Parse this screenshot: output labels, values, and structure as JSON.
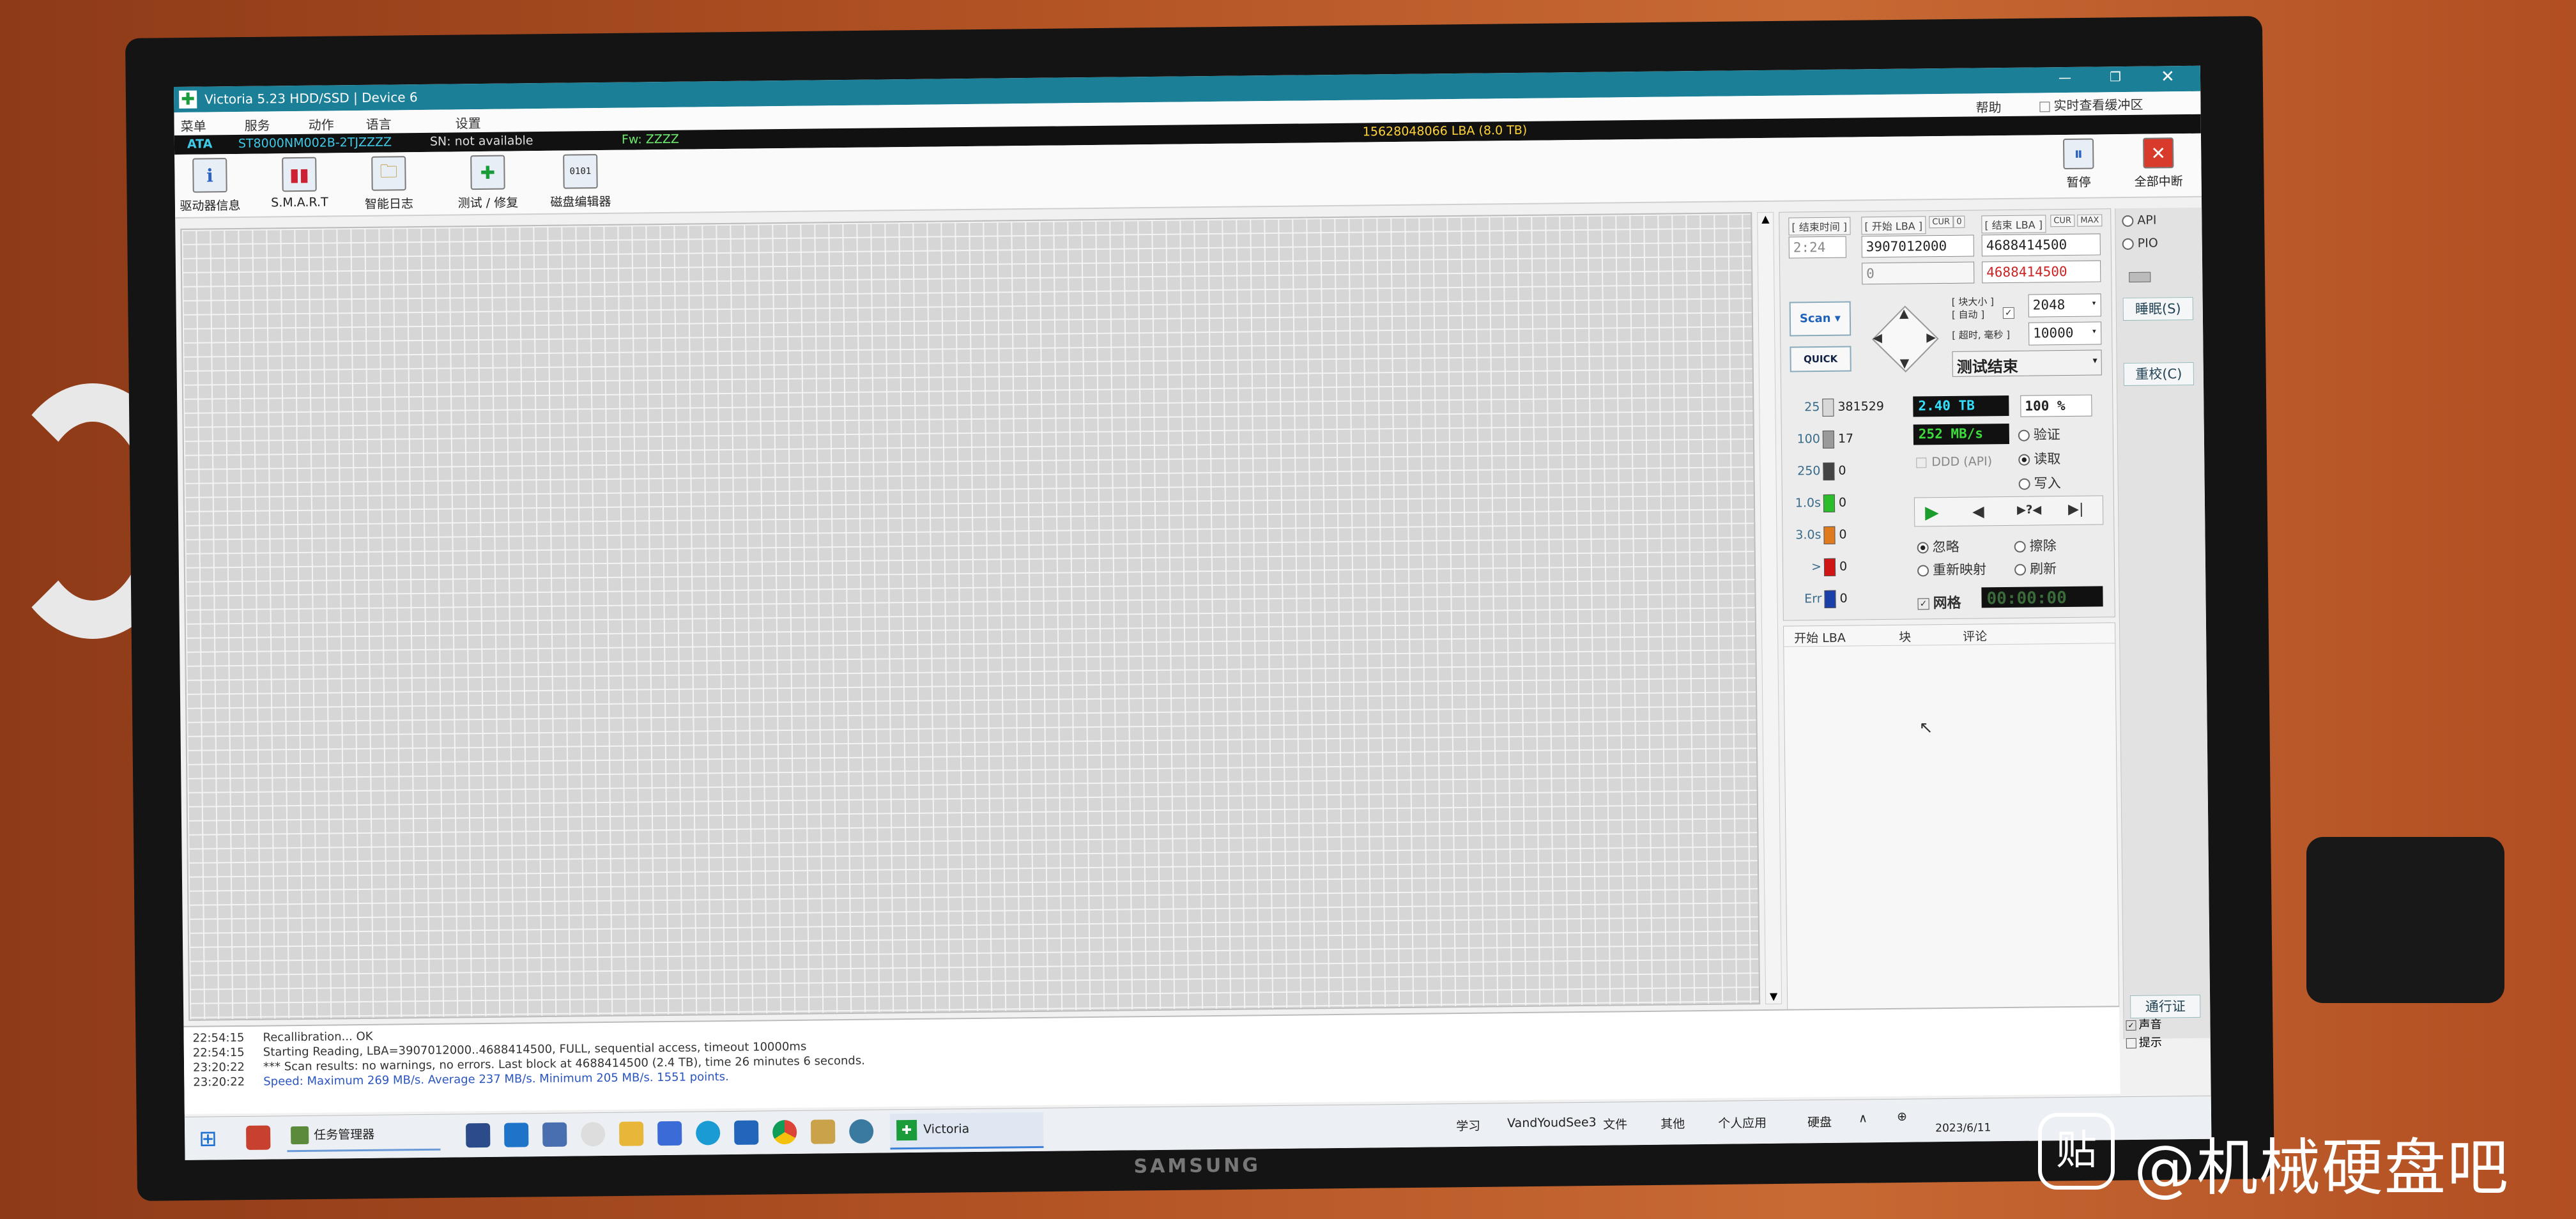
{
  "window": {
    "title": "Victoria 5.23 HDD/SSD | Device 6"
  },
  "menu": {
    "items": [
      "菜单",
      "服务",
      "动作",
      "语言",
      "设置"
    ],
    "help": "帮助",
    "realtime": "实时查看缓冲区"
  },
  "info": {
    "iface": "ATA",
    "model": "ST8000NM002B-2TJZZZZ",
    "sn": "SN: not available",
    "fw": "Fw: ZZZZ",
    "capacity": "15628048066 LBA (8.0 TB)"
  },
  "toolbar": {
    "buttons": [
      "驱动器信息",
      "S.M.A.R.T",
      "智能日志",
      "测试 / 修复",
      "磁盘编辑器"
    ],
    "pause": "暂停",
    "abort": "全部中断"
  },
  "scan": {
    "time_label": "[ 结束时间 ]",
    "time_value": "2:24",
    "start_label": "[ 开始 LBA ]",
    "cur": "CUR",
    "zero": "0",
    "start_value": "3907012000",
    "end_label": "[ 结束 LBA ]",
    "max": "MAX",
    "end_value": "4688414500",
    "pos_value": "0",
    "end_cur": "4688414500",
    "scan_btn": "Scan",
    "quick_btn": "QUICK",
    "block_label": "[ 块大小 ]",
    "auto_label": "[ 自动 ]",
    "block_value": "2048",
    "timeout_label": "[ 超时, 毫秒 ]",
    "timeout_value": "10000",
    "status": "测试结束"
  },
  "counts": [
    {
      "label": "25",
      "value": "381529",
      "color": "#d8d8d8"
    },
    {
      "label": "100",
      "value": "17",
      "color": "#9a9a9a"
    },
    {
      "label": "250",
      "value": "0",
      "color": "#444444"
    },
    {
      "label": "1.0s",
      "value": "0",
      "color": "#2bbd2b"
    },
    {
      "label": "3.0s",
      "value": "0",
      "color": "#e07a1e"
    },
    {
      "label": ">",
      "value": "0",
      "color": "#d01515"
    },
    {
      "label": "Err",
      "value": "0",
      "color": "#1b3fa8"
    }
  ],
  "stats": {
    "size": "2.40 TB",
    "percent": "100",
    "pct_sign": "%",
    "speed": "252 MB/s",
    "ddd": "DDD (API)"
  },
  "modes": {
    "verify": "验证",
    "read": "读取",
    "write": "写入"
  },
  "actions": {
    "ignore": "忽略",
    "erase": "擦除",
    "remap": "重新映射",
    "refresh": "刷新"
  },
  "grid_chk": "网格",
  "timer": "00:00:00",
  "table": {
    "col_lba": "开始 LBA",
    "col_block": "块",
    "col_comment": "评论"
  },
  "right": {
    "api": "API",
    "pio": "PIO",
    "sleep": "睡眠(S)",
    "recal": "重校(C)",
    "pass": "通行证",
    "sound": "声音",
    "hint": "提示"
  },
  "log": [
    {
      "time": "22:54:15",
      "text": "Recallibration... OK"
    },
    {
      "time": "22:54:15",
      "text": "Starting Reading, LBA=3907012000..4688414500, FULL, sequential access, timeout 10000ms"
    },
    {
      "time": "23:20:22",
      "text": "*** Scan results: no warnings, no errors. Last block at 4688414500 (2.4 TB), time 26 minutes 6 seconds."
    },
    {
      "time": "23:20:22",
      "text": "Speed: Maximum 269 MB/s. Average 237 MB/s. Minimum 205 MB/s. 1551 points."
    }
  ],
  "taskbar": {
    "task_manager": "任务管理器",
    "victoria": "Victoria",
    "folders": [
      "学习",
      "VandYoudSee3",
      "文件",
      "其他",
      "个人应用",
      "硬盘"
    ],
    "date": "2023/6/11"
  },
  "monitor_brand": "SAMSUNG",
  "watermark": {
    "glyph": "贴",
    "text": "@机械硬盘吧"
  }
}
